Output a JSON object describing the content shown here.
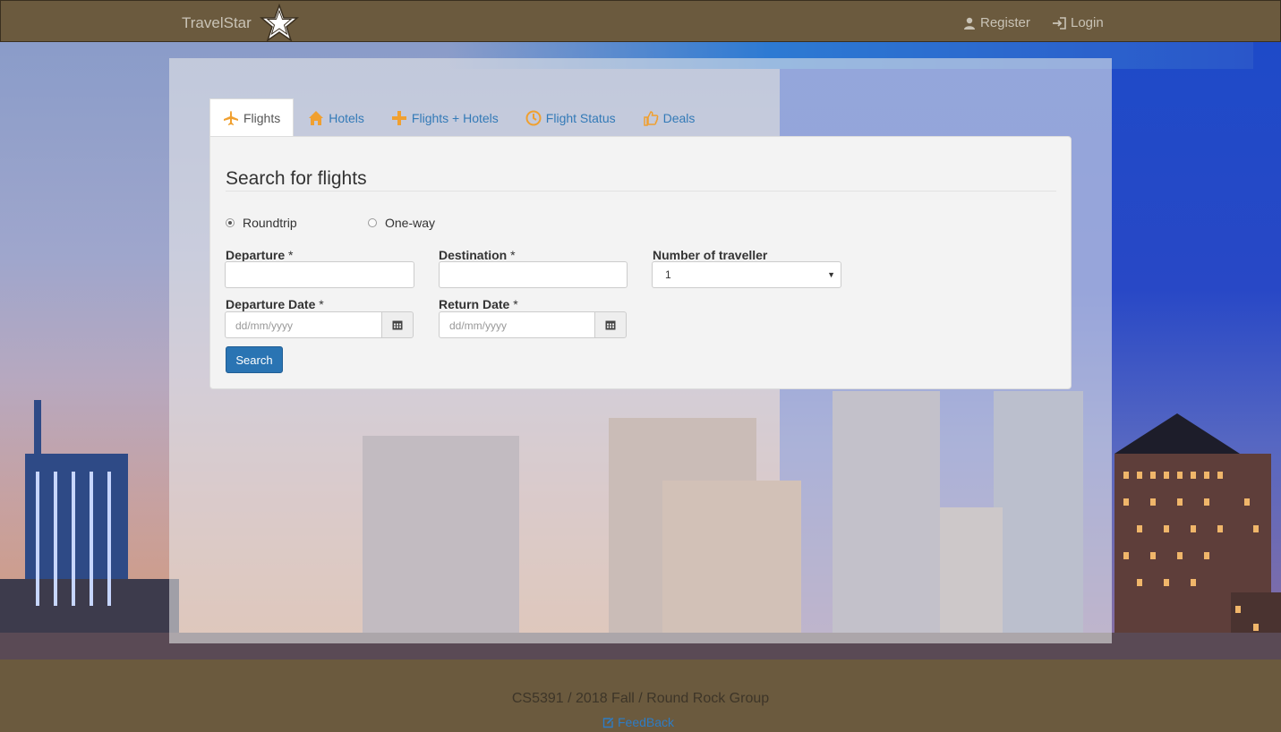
{
  "navbar": {
    "brand": "TravelStar",
    "register": "Register",
    "login": "Login"
  },
  "tabs": [
    {
      "label": "Flights",
      "icon": "plane-icon",
      "active": true
    },
    {
      "label": "Hotels",
      "icon": "home-icon",
      "active": false
    },
    {
      "label": "Flights + Hotels",
      "icon": "plus-icon",
      "active": false
    },
    {
      "label": "Flight Status",
      "icon": "clock-icon",
      "active": false
    },
    {
      "label": "Deals",
      "icon": "thumbs-up-icon",
      "active": false
    }
  ],
  "search": {
    "title": "Search for flights",
    "trip_types": [
      {
        "label": "Roundtrip",
        "selected": true
      },
      {
        "label": "One-way",
        "selected": false
      }
    ],
    "departure": {
      "label": "Departure",
      "required_mark": "*",
      "value": ""
    },
    "destination": {
      "label": "Destination",
      "required_mark": "*",
      "value": ""
    },
    "travellers": {
      "label": "Number of traveller",
      "value": "1"
    },
    "departure_date": {
      "label": "Departure Date",
      "required_mark": "*",
      "placeholder": "dd/mm/yyyy"
    },
    "return_date": {
      "label": "Return Date",
      "required_mark": "*",
      "placeholder": "dd/mm/yyyy"
    },
    "button": "Search"
  },
  "footer": {
    "text": "CS5391 / 2018 Fall / Round Rock Group",
    "feedback": "FeedBack"
  },
  "colors": {
    "navbar_bg": "#6b5a3e",
    "accent_orange": "#f0a030",
    "link_blue": "#337ab7",
    "button_blue": "#2a74b3"
  }
}
